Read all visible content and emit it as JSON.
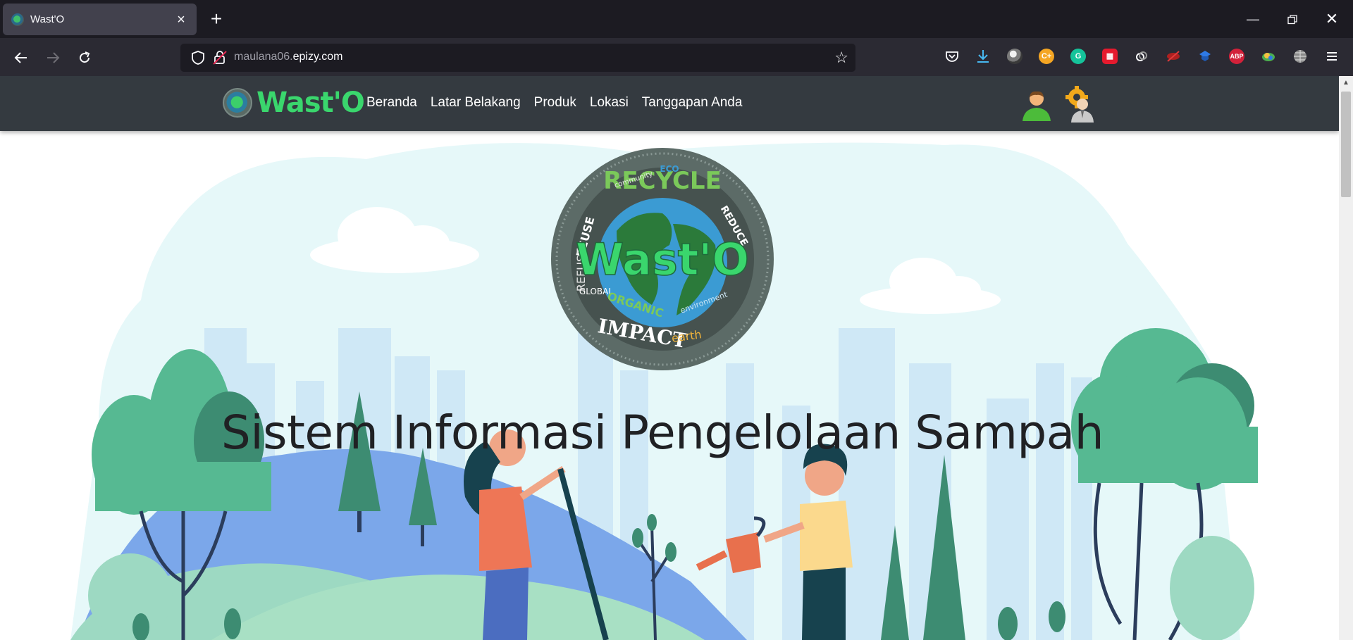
{
  "browser": {
    "tab_title": "Wast'O",
    "new_tab_symbol": "+",
    "url_prefix": "maulana06.",
    "url_host": "epizy.com"
  },
  "site": {
    "brand": "Wast'O",
    "menu": [
      "Beranda",
      "Latar Belakang",
      "Produk",
      "Lokasi",
      "Tanggapan Anda"
    ]
  },
  "hero": {
    "title": "Sistem Informasi Pengelolaan Sampah",
    "logo_text": "Wast'O",
    "logo_words": [
      "RECYCLE",
      "REDUCE",
      "REUSE",
      "REFUSE",
      "GLOBAL",
      "ORGANIC",
      "IMPACT",
      "environment",
      "community",
      "ECO",
      "earth"
    ]
  },
  "extensions": [
    "pocket-icon",
    "download-icon",
    "avatar-icon",
    "cplus-icon",
    "grammarly-icon",
    "mega-icon",
    "link-icon",
    "eye-icon",
    "shield-ext-icon",
    "ABP",
    "vpn-icon",
    "globe-icon"
  ],
  "colors": {
    "brand_green": "#3ad66d",
    "navbar": "#343a40",
    "hero_sky": "#e6f8f9",
    "tree_green": "#56b992"
  }
}
